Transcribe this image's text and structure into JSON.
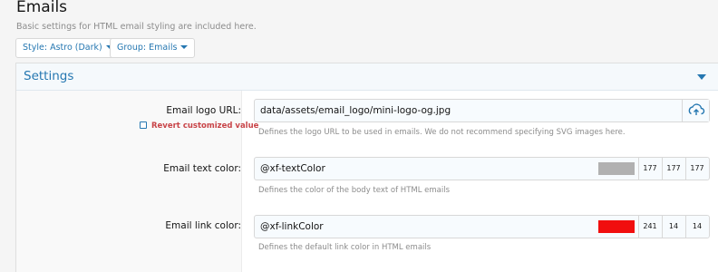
{
  "page": {
    "title": "Emails",
    "description": "Basic settings for HTML email styling are included here."
  },
  "toolbar": {
    "style_button": "Style: Astro (Dark)",
    "group_button": "Group: Emails"
  },
  "block": {
    "title": "Settings"
  },
  "settings": [
    {
      "label": "Email logo URL:",
      "value": "data/assets/email_logo/mini-logo-og.jpg",
      "explain": "Defines the logo URL to be used in emails. We do not recommend specifying SVG images here.",
      "revert_label": "Revert customized value",
      "icon": "upload-icon"
    },
    {
      "label": "Email text color:",
      "value": "@xf-textColor",
      "explain": "Defines the color of the body text of HTML emails",
      "swatch_color": "#b1b1b1",
      "rgb": [
        "177",
        "177",
        "177"
      ]
    },
    {
      "label": "Email link color:",
      "value": "@xf-linkColor",
      "explain": "Defines the default link color in HTML emails",
      "swatch_color": "#f10e0e",
      "rgb": [
        "241",
        "14",
        "14"
      ]
    }
  ],
  "colors": {
    "accent": "#2577b1",
    "revert": "#c84448"
  }
}
